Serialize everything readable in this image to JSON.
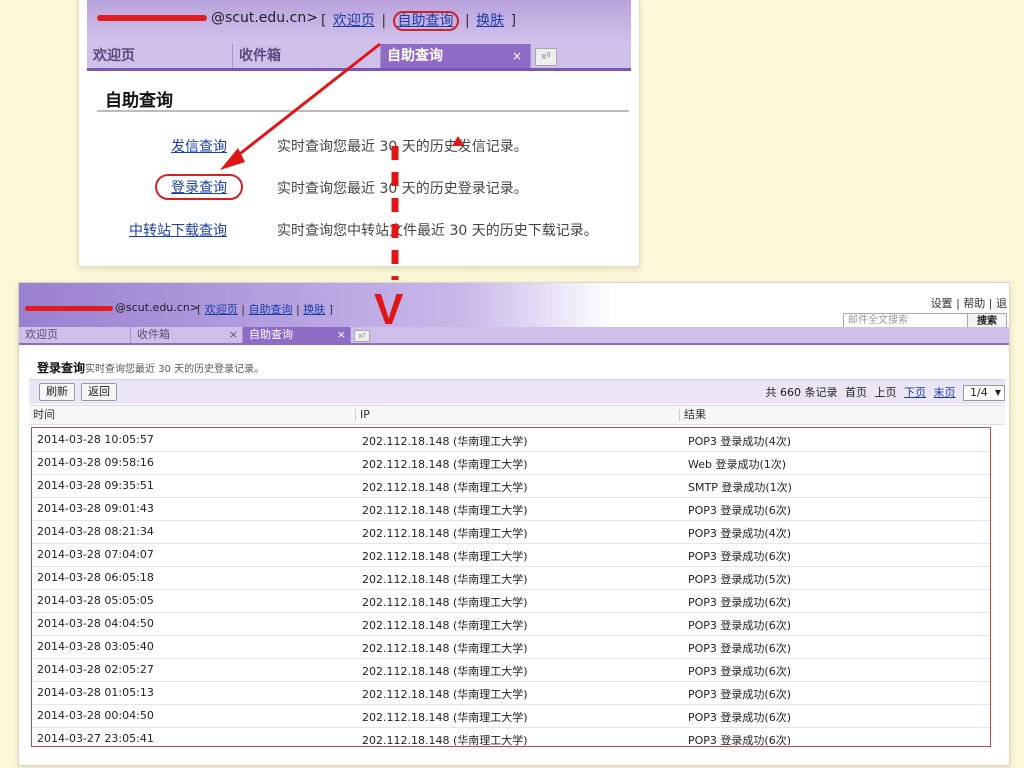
{
  "top": {
    "user_name_tail": "@scut.edu.cn>",
    "nav": {
      "open": "[",
      "welcome": "欢迎页",
      "sep1": "|",
      "self_query": "自助查询",
      "sep2": "|",
      "skin": "换肤",
      "close": "]"
    },
    "tabs": [
      {
        "label": "欢迎页"
      },
      {
        "label": "收件箱"
      },
      {
        "label": "自助查询",
        "close": "×"
      }
    ],
    "tab_add": "xº",
    "title": "自助查询",
    "items": [
      {
        "label": "发信查询",
        "desc": "实时查询您最近  30  天的历史发信记录。"
      },
      {
        "label": "登录查询",
        "desc": "实时查询您最近  30  天的历史登录记录。"
      },
      {
        "label": "中转站下载查询",
        "desc": "实时查询您中转站文件最近  30  天的历史下载记录。"
      }
    ]
  },
  "annotation": {
    "down_mark": "V"
  },
  "bottom": {
    "user_name_tail": "@scut.edu.cn>",
    "nav": {
      "open": "[",
      "welcome": "欢迎页",
      "sep1": "|",
      "self_query": "自助查询",
      "sep2": "|",
      "skin": "换肤",
      "close": "]"
    },
    "top_links": {
      "settings": "设置",
      "sep": "|",
      "help": "帮助",
      "sep2": "|",
      "logout": "退"
    },
    "search": {
      "placeholder": "邮件全文搜索",
      "button": "搜索"
    },
    "tabs": [
      {
        "label": "欢迎页"
      },
      {
        "label": "收件箱",
        "close": "×"
      },
      {
        "label": "自助查询",
        "close": "×"
      }
    ],
    "tab_add": "xº",
    "title": "登录查询",
    "subtitle": "实时查询您最近  30 天的历史登录记录。",
    "buttons": {
      "refresh": "刷新",
      "back": "返回"
    },
    "pager": {
      "total": "共  660 条记录",
      "first": "首页",
      "prev": "上页",
      "next": "下页",
      "last": "末页",
      "page": "1/4"
    },
    "columns": [
      "时间",
      "IP",
      "结果"
    ],
    "rows": [
      {
        "time": "2014-03-28 10:05:57",
        "ip": "202.112.18.148 (华南理工大学)",
        "result": "POP3 登录成功(4次)"
      },
      {
        "time": "2014-03-28 09:58:16",
        "ip": "202.112.18.148 (华南理工大学)",
        "result": "Web 登录成功(1次)"
      },
      {
        "time": "2014-03-28 09:35:51",
        "ip": "202.112.18.148 (华南理工大学)",
        "result": "SMTP 登录成功(1次)"
      },
      {
        "time": "2014-03-28 09:01:43",
        "ip": "202.112.18.148 (华南理工大学)",
        "result": "POP3 登录成功(6次)"
      },
      {
        "time": "2014-03-28 08:21:34",
        "ip": "202.112.18.148 (华南理工大学)",
        "result": "POP3 登录成功(4次)"
      },
      {
        "time": "2014-03-28 07:04:07",
        "ip": "202.112.18.148 (华南理工大学)",
        "result": "POP3 登录成功(6次)"
      },
      {
        "time": "2014-03-28 06:05:18",
        "ip": "202.112.18.148 (华南理工大学)",
        "result": "POP3 登录成功(5次)"
      },
      {
        "time": "2014-03-28 05:05:05",
        "ip": "202.112.18.148 (华南理工大学)",
        "result": "POP3 登录成功(6次)"
      },
      {
        "time": "2014-03-28 04:04:50",
        "ip": "202.112.18.148 (华南理工大学)",
        "result": "POP3 登录成功(6次)"
      },
      {
        "time": "2014-03-28 03:05:40",
        "ip": "202.112.18.148 (华南理工大学)",
        "result": "POP3 登录成功(6次)"
      },
      {
        "time": "2014-03-28 02:05:27",
        "ip": "202.112.18.148 (华南理工大学)",
        "result": "POP3 登录成功(6次)"
      },
      {
        "time": "2014-03-28 01:05:13",
        "ip": "202.112.18.148 (华南理工大学)",
        "result": "POP3 登录成功(6次)"
      },
      {
        "time": "2014-03-28 00:04:50",
        "ip": "202.112.18.148 (华南理工大学)",
        "result": "POP3 登录成功(6次)"
      },
      {
        "time": "2014-03-27 23:05:41",
        "ip": "202.112.18.148 (华南理工大学)",
        "result": "POP3 登录成功(6次)"
      }
    ]
  },
  "colors": {
    "page_bg": "#fbf8d8",
    "purple": "#8e6cc6",
    "annotation_red": "#e01515",
    "link": "#1a3fa8"
  }
}
